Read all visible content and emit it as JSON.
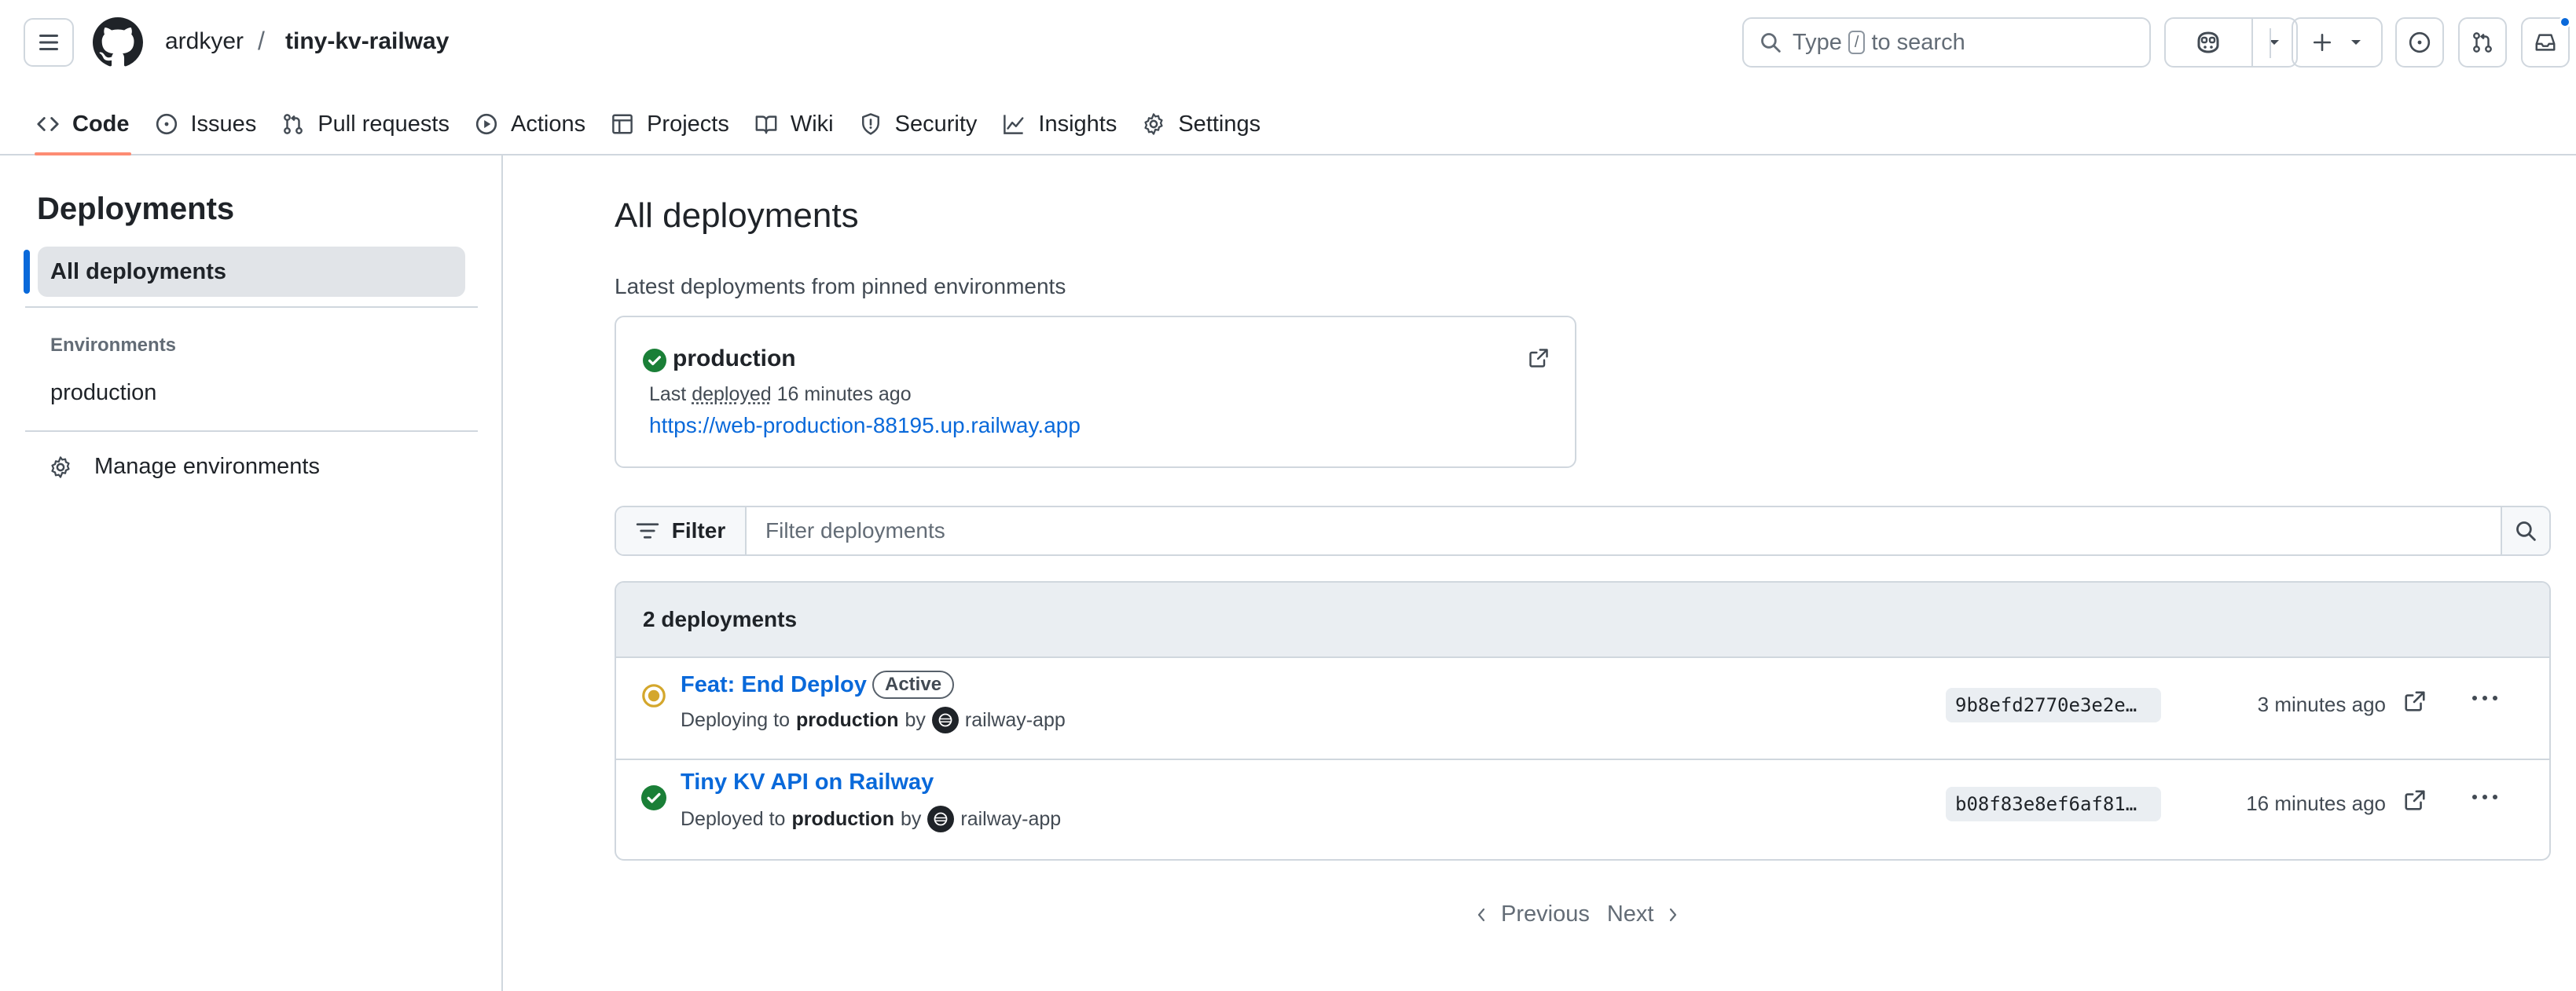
{
  "header": {
    "owner": "ardkyer",
    "separator": "/",
    "repo": "tiny-kv-railway",
    "search_prefix": "Type",
    "search_key": "/",
    "search_suffix": "to search"
  },
  "repo_nav": [
    {
      "label": "Code",
      "icon": "code-icon",
      "active": true
    },
    {
      "label": "Issues",
      "icon": "issue-icon"
    },
    {
      "label": "Pull requests",
      "icon": "pull-request-icon"
    },
    {
      "label": "Actions",
      "icon": "play-icon"
    },
    {
      "label": "Projects",
      "icon": "table-icon"
    },
    {
      "label": "Wiki",
      "icon": "book-icon"
    },
    {
      "label": "Security",
      "icon": "shield-icon"
    },
    {
      "label": "Insights",
      "icon": "graph-icon"
    },
    {
      "label": "Settings",
      "icon": "gear-icon"
    }
  ],
  "sidebar": {
    "title": "Deployments",
    "active_item": "All deployments",
    "environments_heading": "Environments",
    "environments": [
      "production"
    ],
    "manage_label": "Manage environments"
  },
  "main": {
    "title": "All deployments",
    "latest_label": "Latest deployments from pinned environments",
    "pinned": {
      "name": "production",
      "last_prefix": "Last",
      "last_verb": "deployed",
      "last_time": "16 minutes ago",
      "url": "https://web-production-88195.up.railway.app"
    },
    "filter": {
      "button_label": "Filter",
      "placeholder": "Filter deployments"
    },
    "list": {
      "count_label": "2 deployments",
      "rows": [
        {
          "title": "Feat: End Deploy",
          "badge": "Active",
          "status": "in-progress",
          "action": "Deploying to",
          "env": "production",
          "by": "by",
          "actor": "railway-app",
          "sha": "9b8efd2770e3e2e…",
          "time": "3 minutes ago"
        },
        {
          "title": "Tiny KV API on Railway",
          "badge": "",
          "status": "success",
          "action": "Deployed to",
          "env": "production",
          "by": "by",
          "actor": "railway-app",
          "sha": "b08f83e8ef6af81…",
          "time": "16 minutes ago"
        }
      ]
    },
    "pager": {
      "previous": "Previous",
      "next": "Next"
    }
  },
  "colors": {
    "accent": "#0969da",
    "success": "#1a7f37",
    "pending": "#d4a72c",
    "tab_underline": "#fd8c73"
  }
}
